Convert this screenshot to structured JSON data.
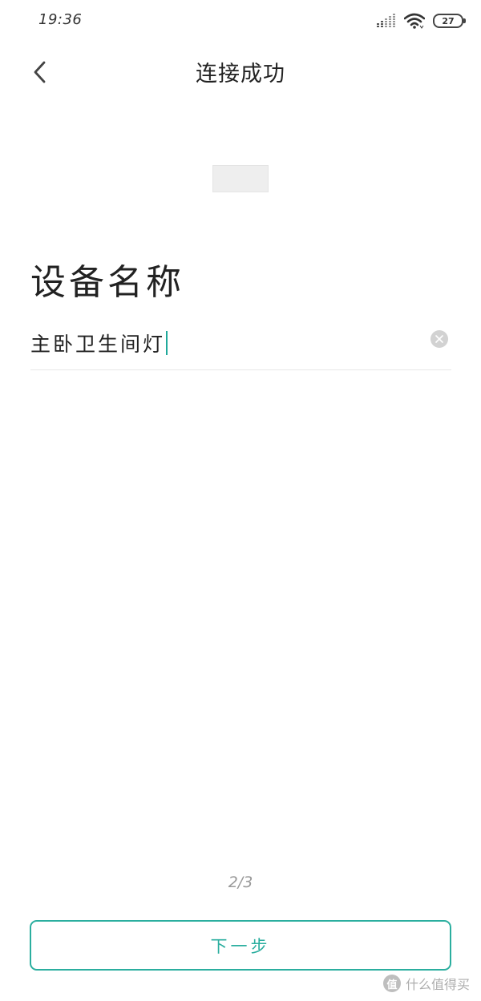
{
  "status_bar": {
    "time": "19:36",
    "battery_level": "27",
    "signal_icon": "cellular-signal-icon",
    "wifi_icon": "wifi-icon"
  },
  "nav": {
    "back_icon": "chevron-left-icon",
    "title": "连接成功"
  },
  "device": {
    "image_icon": "device-image-placeholder"
  },
  "form": {
    "heading": "设备名称",
    "name_value": "主卧卫生间灯",
    "clear_icon": "clear-icon"
  },
  "pager": {
    "indicator": "2/3",
    "next_label": "下一步"
  },
  "watermark": {
    "logo_glyph": "值",
    "text": "什么值得买"
  },
  "colors": {
    "accent": "#2bae9f",
    "caret": "#20a99b",
    "text": "#222222",
    "muted": "#9a9a9a"
  }
}
